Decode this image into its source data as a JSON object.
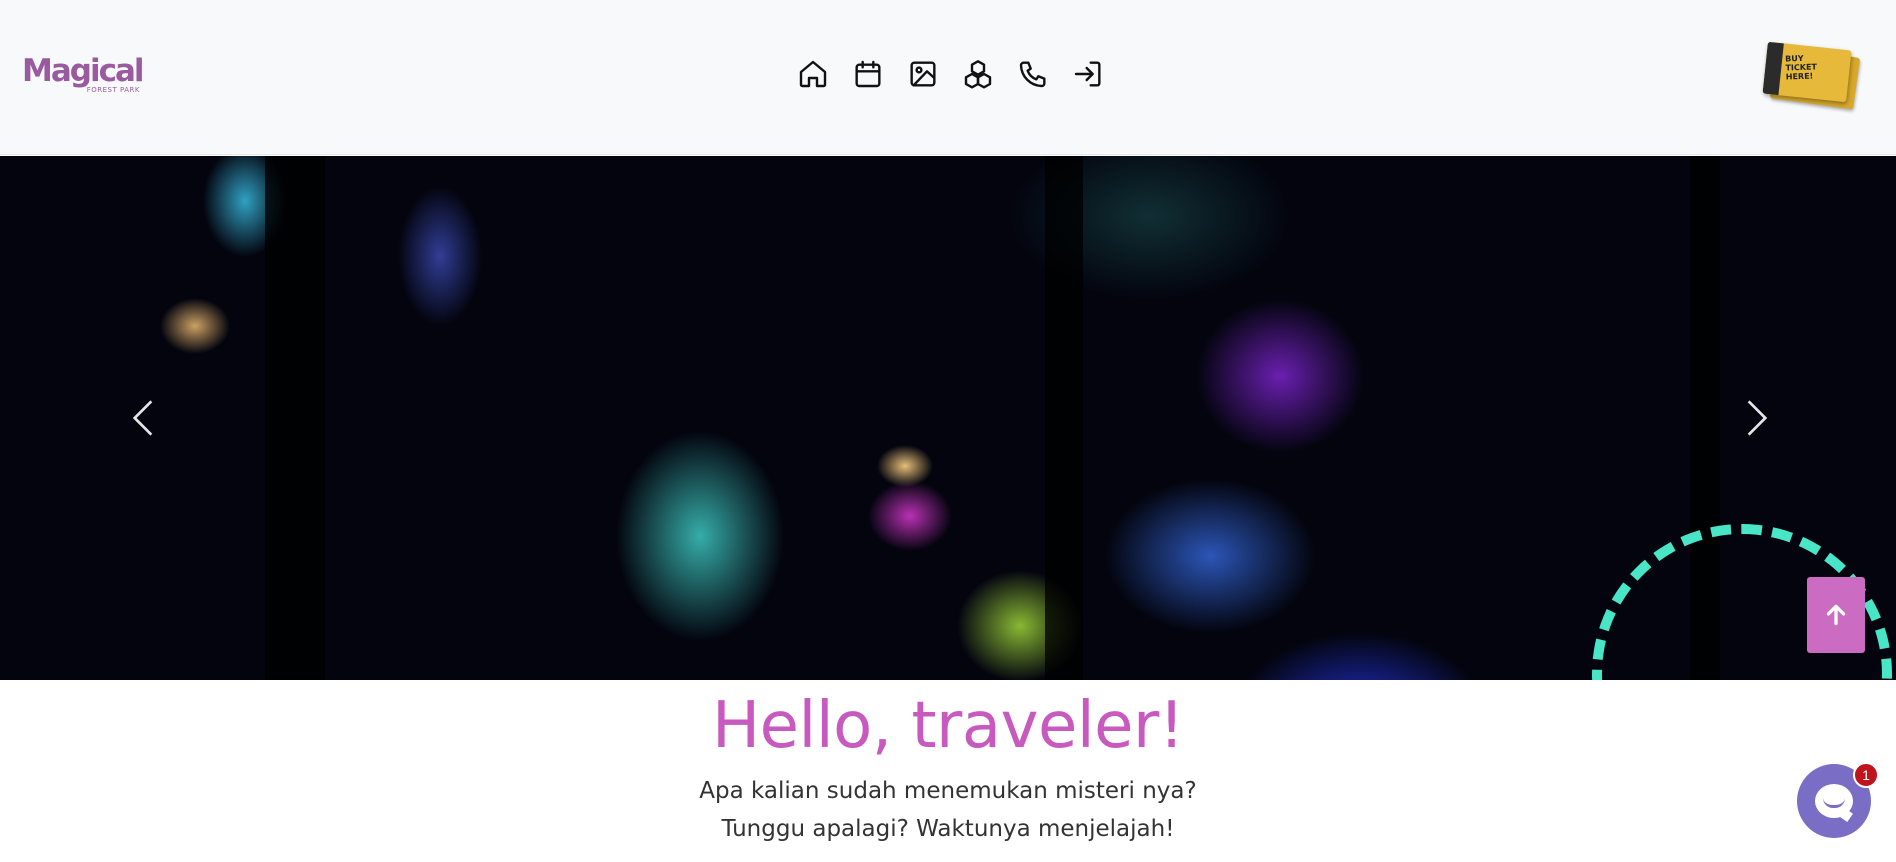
{
  "header": {
    "logo": {
      "title": "Magical",
      "subtitle": "FOREST PARK"
    },
    "nav": [
      {
        "id": "home",
        "icon": "home-icon"
      },
      {
        "id": "calendar",
        "icon": "calendar-icon"
      },
      {
        "id": "gallery",
        "icon": "image-icon"
      },
      {
        "id": "attractions",
        "icon": "cubes-icon"
      },
      {
        "id": "contact",
        "icon": "phone-icon"
      },
      {
        "id": "login",
        "icon": "sign-in-icon"
      }
    ],
    "ticket": {
      "text": "BUY TICKET HERE!",
      "icon": "ticket-icon"
    }
  },
  "hero": {
    "prev_icon": "chevron-left-icon",
    "next_icon": "chevron-right-icon"
  },
  "main": {
    "heading": "Hello, traveler!",
    "line1": "Apa kalian sudah menemukan misteri nya?",
    "line2": "Tunggu apalagi? Waktunya menjelajah!"
  },
  "scroll_top": {
    "icon": "arrow-up-icon"
  },
  "chat": {
    "badge": "1",
    "icon": "chat-icon"
  },
  "colors": {
    "accent": "#c85abf",
    "logo": "#9a5a9f",
    "scroll_button": "#cb6bc2",
    "chat": "#7a6dc6",
    "badge": "#c0141c"
  }
}
